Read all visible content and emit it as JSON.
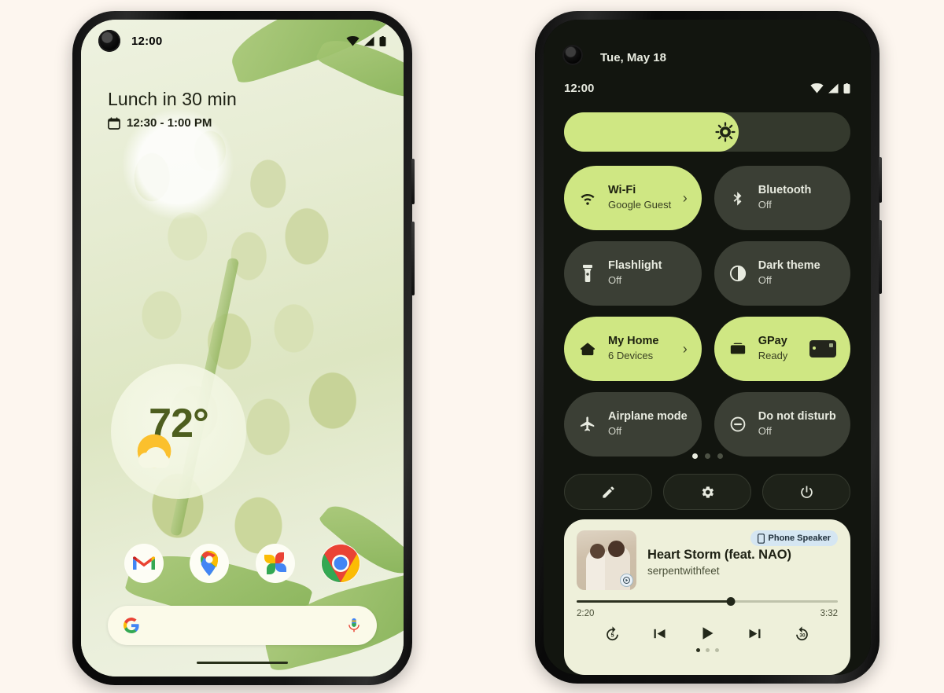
{
  "left_phone": {
    "status_bar": {
      "time": "12:00",
      "icons": [
        "wifi-icon",
        "signal-icon",
        "battery-icon"
      ]
    },
    "glance": {
      "title": "Lunch in 30 min",
      "time_range": "12:30 - 1:00 PM",
      "icon": "calendar-icon"
    },
    "weather": {
      "temperature": "72°",
      "icon": "sun-cloud-icon"
    },
    "dock": [
      {
        "name": "gmail-app-icon",
        "label": "Gmail"
      },
      {
        "name": "maps-app-icon",
        "label": "Maps"
      },
      {
        "name": "photos-app-icon",
        "label": "Photos"
      },
      {
        "name": "chrome-app-icon",
        "label": "Chrome"
      }
    ],
    "search": {
      "logo": "google-g-icon",
      "mic": "microphone-icon",
      "placeholder": ""
    }
  },
  "right_phone": {
    "date": "Tue, May 18",
    "status_bar": {
      "time": "12:00",
      "icons": [
        "wifi-icon",
        "signal-icon",
        "battery-icon"
      ]
    },
    "brightness": {
      "icon": "brightness-icon",
      "level": 61
    },
    "tiles": [
      {
        "label": "Wi-Fi",
        "sub": "Google Guest",
        "icon": "wifi-icon",
        "state": "on",
        "chevron": "›"
      },
      {
        "label": "Bluetooth",
        "sub": "Off",
        "icon": "bluetooth-icon",
        "state": "off"
      },
      {
        "label": "Flashlight",
        "sub": "Off",
        "icon": "flashlight-icon",
        "state": "off"
      },
      {
        "label": "Dark theme",
        "sub": "Off",
        "icon": "dark-theme-icon",
        "state": "off"
      },
      {
        "label": "My Home",
        "sub": "6 Devices",
        "icon": "home-icon",
        "state": "on",
        "chevron": "›"
      },
      {
        "label": "GPay",
        "sub": "Ready",
        "icon": "wallet-icon",
        "state": "on",
        "card": true
      },
      {
        "label": "Airplane mode",
        "sub": "Off",
        "icon": "airplane-icon",
        "state": "off"
      },
      {
        "label": "Do not disturb",
        "sub": "Off",
        "icon": "do-not-disturb-icon",
        "state": "off"
      }
    ],
    "page_dots": {
      "count": 3,
      "active": 0
    },
    "actions": [
      {
        "name": "edit-tiles-button",
        "icon": "pencil-icon"
      },
      {
        "name": "settings-button",
        "icon": "gear-icon"
      },
      {
        "name": "power-button",
        "icon": "power-icon"
      }
    ],
    "media": {
      "title": "Heart Storm (feat. NAO)",
      "artist": "serpentwithfeet",
      "output_device": "Phone Speaker",
      "output_icon": "phone-icon",
      "elapsed": "2:20",
      "duration": "3:32",
      "progress": 59,
      "controls": [
        {
          "name": "replay-5-button",
          "icon": "replay-5-icon"
        },
        {
          "name": "previous-track-button",
          "icon": "skip-previous-icon"
        },
        {
          "name": "play-button",
          "icon": "play-icon"
        },
        {
          "name": "next-track-button",
          "icon": "skip-next-icon"
        },
        {
          "name": "forward-30-button",
          "icon": "forward-30-icon"
        }
      ],
      "page_dots": {
        "count": 3,
        "active": 0
      }
    }
  },
  "colors": {
    "accent_green": "#cfe783",
    "dark_surface": "#3b3f35",
    "screen_dark": "#12150f",
    "page_bg": "#fdf6ef",
    "media_bg": "#eef0da"
  }
}
